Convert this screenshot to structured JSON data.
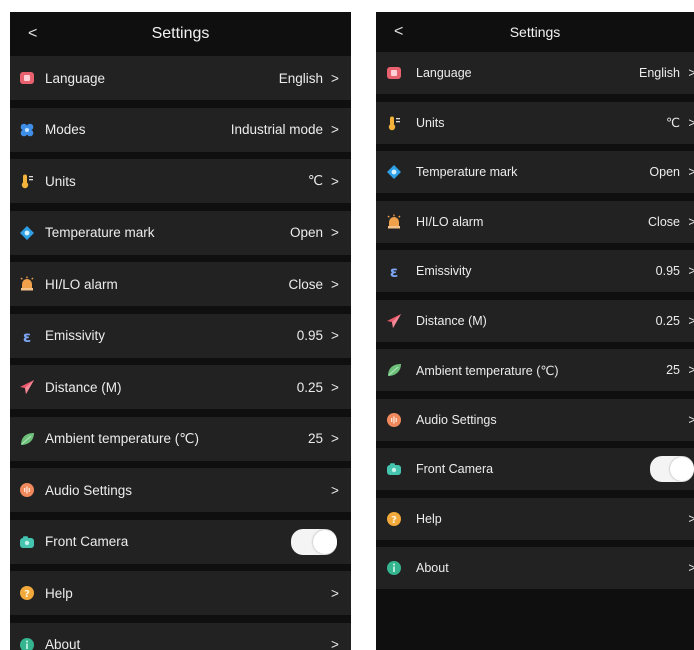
{
  "left": {
    "title": "Settings",
    "back_glyph": "<",
    "rows": [
      {
        "label": "Language",
        "value": "English",
        "icon": "language-icon",
        "kind": "chevron"
      },
      {
        "label": "Modes",
        "value": "Industrial mode",
        "icon": "modes-icon",
        "kind": "chevron"
      },
      {
        "label": "Units",
        "value": "℃",
        "icon": "thermometer-icon",
        "kind": "chevron"
      },
      {
        "label": "Temperature mark",
        "value": "Open",
        "icon": "temperature-mark-icon",
        "kind": "chevron"
      },
      {
        "label": "HI/LO alarm",
        "value": "Close",
        "icon": "alarm-icon",
        "kind": "chevron"
      },
      {
        "label": "Emissivity",
        "value": "0.95",
        "icon": "emissivity-icon",
        "kind": "chevron"
      },
      {
        "label": "Distance (M)",
        "value": "0.25",
        "icon": "distance-icon",
        "kind": "chevron"
      },
      {
        "label": "Ambient temperature (℃)",
        "value": "25",
        "icon": "leaf-icon",
        "kind": "chevron"
      },
      {
        "label": "Audio Settings",
        "value": "",
        "icon": "audio-icon",
        "kind": "chevron"
      },
      {
        "label": "Front Camera",
        "value": "",
        "icon": "camera-icon",
        "kind": "toggle",
        "on": false
      },
      {
        "label": "Help",
        "value": "",
        "icon": "help-icon",
        "kind": "chevron"
      },
      {
        "label": "About",
        "value": "",
        "icon": "about-icon",
        "kind": "chevron"
      }
    ]
  },
  "right": {
    "title": "Settings",
    "back_glyph": "<",
    "rows": [
      {
        "label": "Language",
        "value": "English",
        "icon": "language-icon",
        "kind": "chevron"
      },
      {
        "label": "Units",
        "value": "℃",
        "icon": "thermometer-icon",
        "kind": "chevron"
      },
      {
        "label": "Temperature mark",
        "value": "Open",
        "icon": "temperature-mark-icon",
        "kind": "chevron"
      },
      {
        "label": "HI/LO alarm",
        "value": "Close",
        "icon": "alarm-icon",
        "kind": "chevron"
      },
      {
        "label": "Emissivity",
        "value": "0.95",
        "icon": "emissivity-icon",
        "kind": "chevron"
      },
      {
        "label": "Distance (M)",
        "value": "0.25",
        "icon": "distance-icon",
        "kind": "chevron"
      },
      {
        "label": "Ambient temperature (℃)",
        "value": "25",
        "icon": "leaf-icon",
        "kind": "chevron"
      },
      {
        "label": "Audio Settings",
        "value": "",
        "icon": "audio-icon",
        "kind": "chevron"
      },
      {
        "label": "Front Camera",
        "value": "",
        "icon": "camera-icon",
        "kind": "toggle",
        "on": false
      },
      {
        "label": "Help",
        "value": "",
        "icon": "help-icon",
        "kind": "chevron"
      },
      {
        "label": "About",
        "value": "",
        "icon": "about-icon",
        "kind": "chevron"
      }
    ]
  },
  "chevron_glyph": ">",
  "colors": {
    "background": "#0f0f0f",
    "row": "#222222",
    "text": "#ececec",
    "language": "#e8616f",
    "modes": "#3f8fe8",
    "thermometer": "#f4b23a",
    "temperature_mark": "#2fa0e6",
    "alarm": "#f1a14a",
    "emissivity": "#7da6f5",
    "distance": "#ec5a6e",
    "leaf": "#6cc07a",
    "audio": "#f08a5d",
    "camera": "#45c4b0",
    "help": "#f2a93b",
    "about": "#35b58f"
  }
}
